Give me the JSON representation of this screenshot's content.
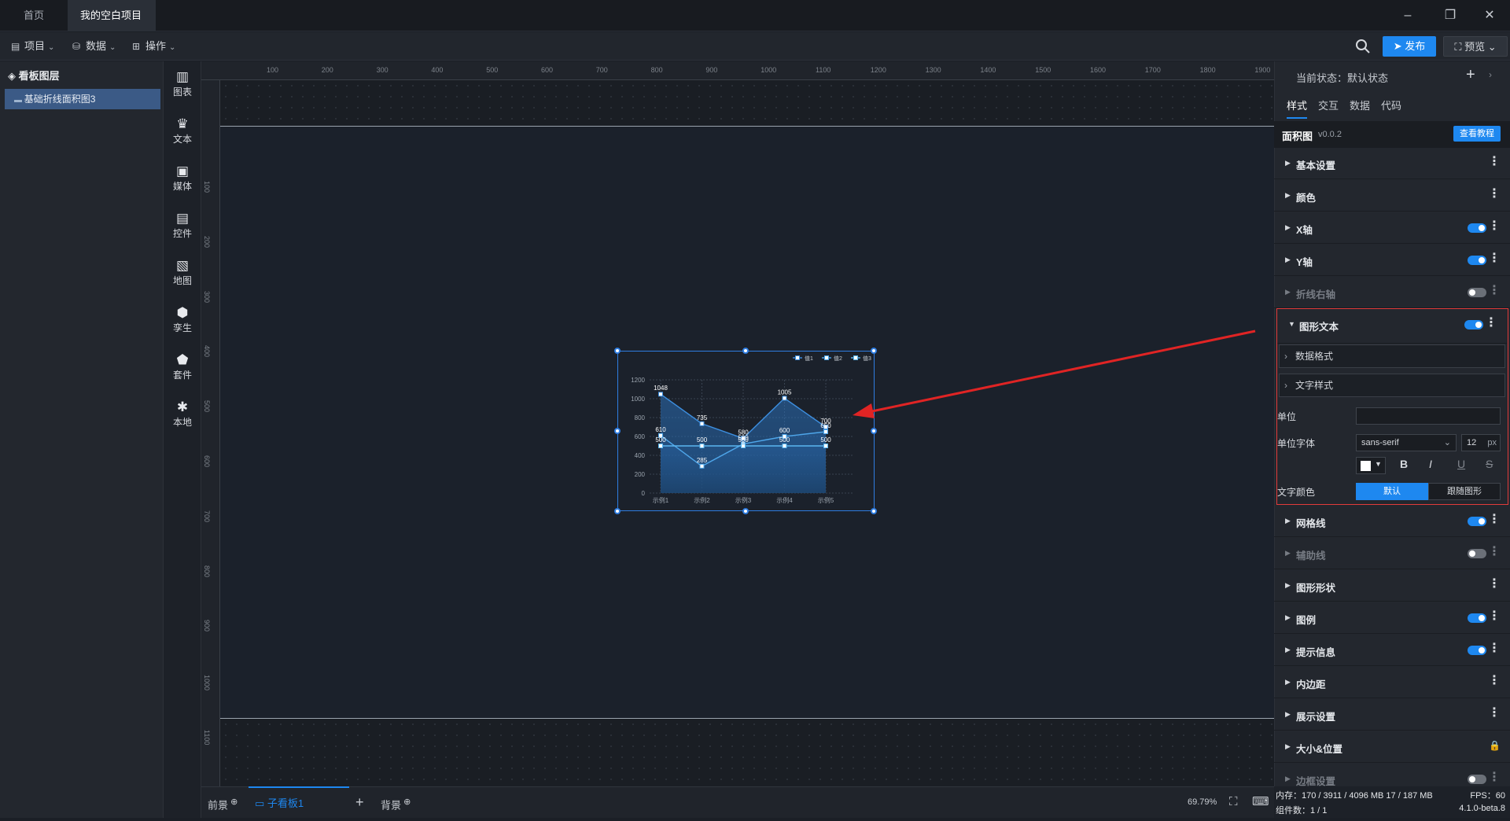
{
  "tabs": {
    "home": "首页",
    "project": "我的空白项目"
  },
  "menu": {
    "project": "项目",
    "data": "数据",
    "operate": "操作",
    "publish": "发布",
    "preview": "预览"
  },
  "layers": {
    "title": "看板图层",
    "item": "基础折线面积图3"
  },
  "tools": [
    {
      "label": "图表",
      "icon": "chart-icon"
    },
    {
      "label": "文本",
      "icon": "text-icon"
    },
    {
      "label": "媒体",
      "icon": "media-icon"
    },
    {
      "label": "控件",
      "icon": "control-icon"
    },
    {
      "label": "地图",
      "icon": "map-icon"
    },
    {
      "label": "孪生",
      "icon": "twin-icon"
    },
    {
      "label": "套件",
      "icon": "kit-icon"
    },
    {
      "label": "本地",
      "icon": "local-icon"
    }
  ],
  "ruler": {
    "top": [
      "100",
      "200",
      "300",
      "400",
      "500",
      "600",
      "700",
      "800",
      "900",
      "1000",
      "1100",
      "1200",
      "1300",
      "1400",
      "1500",
      "1600",
      "1700",
      "1800",
      "1900"
    ],
    "left": [
      "100",
      "200",
      "300",
      "400",
      "500",
      "600",
      "700",
      "800",
      "900",
      "1000",
      "1100"
    ]
  },
  "chart_data": {
    "type": "area",
    "categories": [
      "示例1",
      "示例2",
      "示例3",
      "示例4",
      "示例5"
    ],
    "series": [
      {
        "name": "值1",
        "values": [
          1048,
          735,
          580,
          1005,
          700
        ],
        "color": "#3d8fe0"
      },
      {
        "name": "值2",
        "values": [
          610,
          285,
          520,
          600,
          650
        ],
        "color": "#4ea6ea"
      },
      {
        "name": "值3",
        "values": [
          500,
          500,
          500,
          500,
          500
        ],
        "color": "#5ab6f0"
      }
    ],
    "yticks": [
      "0",
      "200",
      "400",
      "600",
      "800",
      "1000",
      "1200"
    ],
    "ylim": [
      0,
      1200
    ]
  },
  "bottom": {
    "front": "前景",
    "board": "子看板1",
    "back": "背景",
    "zoom": "69.79%"
  },
  "right": {
    "status": "当前状态：默认状态",
    "tabs": [
      "样式",
      "交互",
      "数据",
      "代码"
    ],
    "component": "面积图",
    "version": "v0.0.2",
    "tutorial": "查看教程",
    "sections_top": [
      {
        "label": "基本设置",
        "toggle": null
      },
      {
        "label": "颜色",
        "toggle": null
      },
      {
        "label": "X轴",
        "toggle": "on"
      },
      {
        "label": "Y轴",
        "toggle": "on"
      },
      {
        "label": "折线右轴",
        "toggle": "off"
      }
    ],
    "graphtext": {
      "label": "图形文本",
      "sub1": "数据格式",
      "sub2": "文字样式",
      "unit": "单位",
      "unit_font": "单位字体",
      "font": "sans-serif",
      "size": "12",
      "px": "px",
      "text_color": "文字颜色",
      "default": "默认",
      "follow": "跟随图形",
      "bold": "B",
      "italic": "I",
      "underline": "U",
      "strike": "S"
    },
    "sections_bottom": [
      {
        "label": "网格线",
        "toggle": "on"
      },
      {
        "label": "辅助线",
        "toggle": "off"
      },
      {
        "label": "图形形状",
        "toggle": null
      },
      {
        "label": "图例",
        "toggle": "on"
      },
      {
        "label": "提示信息",
        "toggle": "on"
      },
      {
        "label": "内边距",
        "toggle": null
      },
      {
        "label": "展示设置",
        "toggle": null
      },
      {
        "label": "大小&位置",
        "toggle": "lock"
      },
      {
        "label": "边框设置",
        "toggle": "off"
      }
    ]
  },
  "footer": {
    "mem": "内存：170 / 3911 / 4096 MB  17 / 187 MB",
    "fps": "FPS：60",
    "count": "组件数：1 / 1",
    "ver": "4.1.0-beta.8"
  },
  "colors": {
    "accent": "#1e88f0",
    "highlight": "#e23b3b"
  }
}
